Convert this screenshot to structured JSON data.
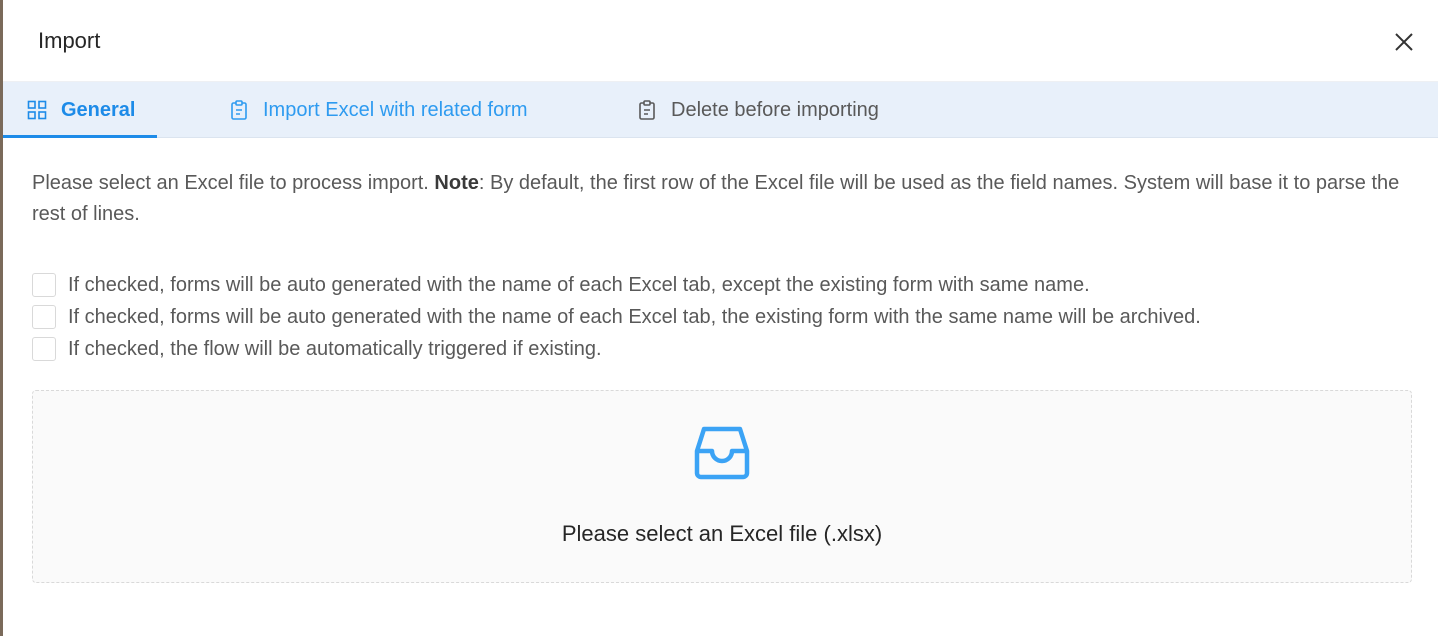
{
  "modal": {
    "title": "Import",
    "close_icon": "close-icon"
  },
  "tabs": [
    {
      "label": "General",
      "icon": "grid-icon",
      "active": true
    },
    {
      "label": "Import Excel with related form",
      "icon": "clipboard-icon",
      "active": false
    },
    {
      "label": "Delete before importing",
      "icon": "clipboard-icon",
      "active": false
    }
  ],
  "note": {
    "prefix": "Please select an Excel file to process import. ",
    "bold": "Note",
    "suffix": ": By default, the first row of the Excel file will be used as the field names. System will base it to parse the rest of lines."
  },
  "options": [
    {
      "label": "If checked, forms will be auto generated with the name of each Excel tab, except the existing form with same name.",
      "checked": false
    },
    {
      "label": "If checked, forms will be auto generated with the name of each Excel tab, the existing form with the same name will be archived.",
      "checked": false
    },
    {
      "label": "If checked, the flow will be automatically triggered if existing.",
      "checked": false
    }
  ],
  "dropzone": {
    "icon": "inbox-icon",
    "text": "Please select an Excel file (.xlsx)"
  },
  "colors": {
    "accent": "#1d8be8",
    "tab_bar": "#e8f0fa"
  }
}
